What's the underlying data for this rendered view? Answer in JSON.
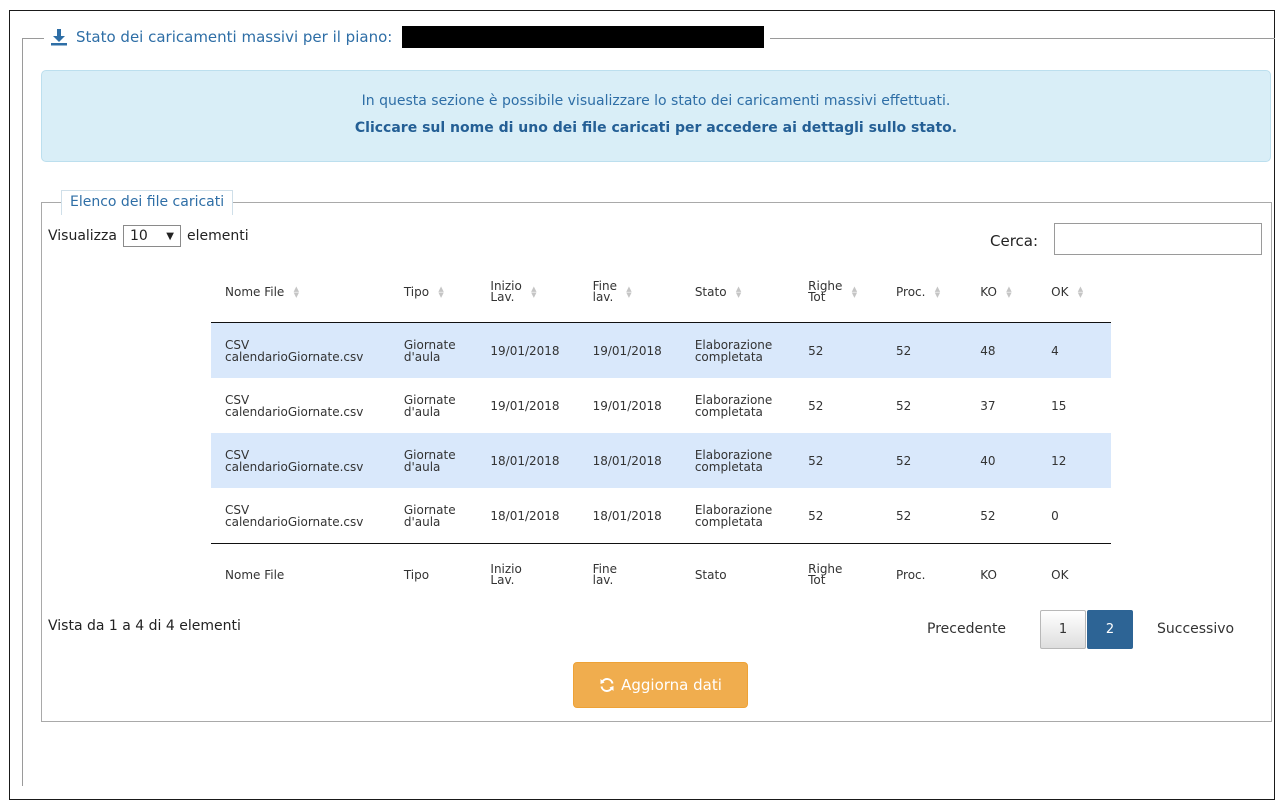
{
  "section": {
    "title": "Stato dei caricamenti massivi per il piano:",
    "icon": "download-icon"
  },
  "info": {
    "line1": "In questa sezione è possibile visualizzare lo stato dei caricamenti massivi effettuati.",
    "line2": "Cliccare sul nome di uno dei file caricati per accedere ai dettagli sullo stato."
  },
  "list": {
    "legend": "Elenco dei file caricati",
    "show_label": "Visualizza",
    "page_size": "10",
    "elements_label": "elementi",
    "search_label": "Cerca:",
    "search_value": ""
  },
  "table": {
    "headers": [
      [
        "Nome File"
      ],
      [
        "Tipo"
      ],
      [
        "Inizio",
        "Lav."
      ],
      [
        "Fine",
        "lav."
      ],
      [
        "Stato"
      ],
      [
        "Righe",
        "Tot"
      ],
      [
        "Proc."
      ],
      [
        "KO"
      ],
      [
        "OK"
      ]
    ],
    "rows": [
      {
        "file": [
          "CSV",
          "calendarioGiornate.csv"
        ],
        "tipo": [
          "Giornate",
          "d'aula"
        ],
        "inizio": "19/01/2018",
        "fine": "19/01/2018",
        "stato": [
          "Elaborazione",
          "completata"
        ],
        "righe": "52",
        "proc": "52",
        "ko": "48",
        "ok": "4"
      },
      {
        "file": [
          "CSV",
          "calendarioGiornate.csv"
        ],
        "tipo": [
          "Giornate",
          "d'aula"
        ],
        "inizio": "19/01/2018",
        "fine": "19/01/2018",
        "stato": [
          "Elaborazione",
          "completata"
        ],
        "righe": "52",
        "proc": "52",
        "ko": "37",
        "ok": "15"
      },
      {
        "file": [
          "CSV",
          "calendarioGiornate.csv"
        ],
        "tipo": [
          "Giornate",
          "d'aula"
        ],
        "inizio": "18/01/2018",
        "fine": "18/01/2018",
        "stato": [
          "Elaborazione",
          "completata"
        ],
        "righe": "52",
        "proc": "52",
        "ko": "40",
        "ok": "12"
      },
      {
        "file": [
          "CSV",
          "calendarioGiornate.csv"
        ],
        "tipo": [
          "Giornate",
          "d'aula"
        ],
        "inizio": "18/01/2018",
        "fine": "18/01/2018",
        "stato": [
          "Elaborazione",
          "completata"
        ],
        "righe": "52",
        "proc": "52",
        "ko": "52",
        "ok": "0"
      }
    ]
  },
  "footer": {
    "count_text": "Vista da 1 a 4 di 4 elementi",
    "prev_label": "Precedente",
    "pages": [
      "1",
      "2"
    ],
    "next_label": "Successivo",
    "refresh_label": "Aggiorna dati"
  },
  "colors": {
    "accent": "#2e6ea6",
    "info_bg": "#d9eef7",
    "row_highlight": "#d9e8fb",
    "active_page": "#2d6495",
    "refresh_button": "#f0ad4e"
  }
}
